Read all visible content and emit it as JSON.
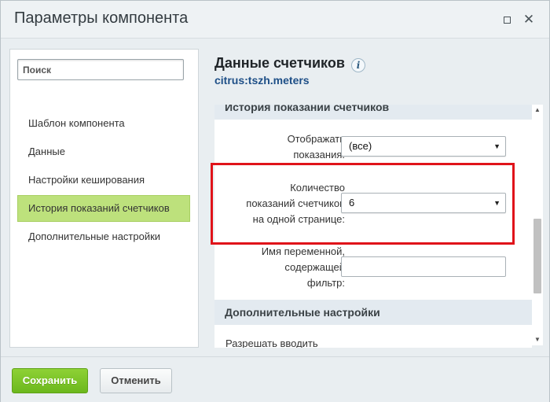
{
  "window": {
    "title": "Параметры компонента"
  },
  "sidebar": {
    "search_placeholder": "Поиск",
    "items": [
      {
        "label": "Шаблон компонента"
      },
      {
        "label": "Данные"
      },
      {
        "label": "Настройки кеширования"
      },
      {
        "label": "История показаний счетчиков",
        "active": true
      },
      {
        "label": "Дополнительные настройки"
      }
    ]
  },
  "component": {
    "title": "Данные счетчиков",
    "code": "citrus:tszh.meters",
    "info_glyph": "i"
  },
  "form": {
    "section_history": "История показаний счетчиков",
    "display_label_1": "Отображать",
    "display_label_2": "показания:",
    "display_value": "(все)",
    "count_label_1": "Количество",
    "count_label_2": "показаний счетчиков",
    "count_label_3": "на одной странице:",
    "count_value": "6",
    "filter_label_1": "Имя переменной,",
    "filter_label_2": "содержащей",
    "filter_label_3": "фильтр:",
    "filter_value": "",
    "section_extra": "Дополнительные настройки",
    "cut_label": "Разрешать вводить"
  },
  "footer": {
    "save_label": "Сохранить",
    "cancel_label": "Отменить"
  },
  "colors": {
    "active_nav": "#bde17c",
    "save_button": "#7cc428",
    "highlight": "#e0131a",
    "link": "#1e4f87"
  }
}
